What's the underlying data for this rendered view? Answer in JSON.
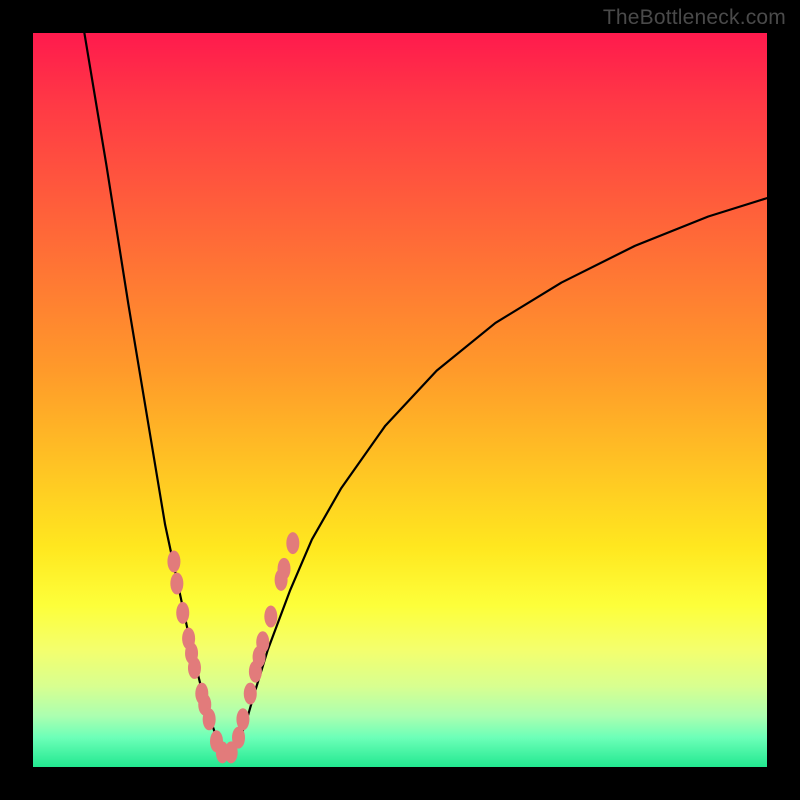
{
  "watermark": "TheBottleneck.com",
  "chart_data": {
    "type": "line",
    "title": "",
    "xlabel": "",
    "ylabel": "",
    "xlim": [
      0,
      100
    ],
    "ylim": [
      0,
      100
    ],
    "grid": false,
    "legend": false,
    "curve_description": "Sharp V-shaped bottleneck curve descending steeply to a minimum near x≈26 then rising more gradually toward the right edge",
    "series": [
      {
        "name": "left-branch",
        "x": [
          7.0,
          10.0,
          13.0,
          16.0,
          18.0,
          19.5,
          21.0,
          22.0,
          23.0,
          24.0,
          25.0,
          25.5,
          26.0
        ],
        "y": [
          100.0,
          82.0,
          63.0,
          45.0,
          33.0,
          26.0,
          19.0,
          14.5,
          10.5,
          7.0,
          4.0,
          2.5,
          1.5
        ]
      },
      {
        "name": "right-branch",
        "x": [
          26.0,
          27.0,
          28.0,
          29.0,
          30.0,
          32.0,
          35.0,
          38.0,
          42.0,
          48.0,
          55.0,
          63.0,
          72.0,
          82.0,
          92.0,
          100.0
        ],
        "y": [
          1.5,
          2.0,
          3.5,
          6.0,
          9.5,
          16.0,
          24.0,
          31.0,
          38.0,
          46.5,
          54.0,
          60.5,
          66.0,
          71.0,
          75.0,
          77.5
        ]
      }
    ],
    "highlight_points": {
      "name": "highlight-ovals",
      "color": "#e27b7b",
      "points": [
        {
          "x": 19.2,
          "y": 28.0
        },
        {
          "x": 19.6,
          "y": 25.0
        },
        {
          "x": 20.4,
          "y": 21.0
        },
        {
          "x": 21.2,
          "y": 17.5
        },
        {
          "x": 21.6,
          "y": 15.5
        },
        {
          "x": 22.0,
          "y": 13.5
        },
        {
          "x": 23.0,
          "y": 10.0
        },
        {
          "x": 23.4,
          "y": 8.5
        },
        {
          "x": 24.0,
          "y": 6.5
        },
        {
          "x": 25.0,
          "y": 3.5
        },
        {
          "x": 25.8,
          "y": 2.0
        },
        {
          "x": 27.0,
          "y": 2.0
        },
        {
          "x": 28.0,
          "y": 4.0
        },
        {
          "x": 28.6,
          "y": 6.5
        },
        {
          "x": 29.6,
          "y": 10.0
        },
        {
          "x": 30.3,
          "y": 13.0
        },
        {
          "x": 30.8,
          "y": 15.0
        },
        {
          "x": 31.3,
          "y": 17.0
        },
        {
          "x": 32.4,
          "y": 20.5
        },
        {
          "x": 33.8,
          "y": 25.5
        },
        {
          "x": 34.2,
          "y": 27.0
        },
        {
          "x": 35.4,
          "y": 30.5
        }
      ]
    },
    "gradient_stops": [
      {
        "pos": 0.0,
        "color": "#ff1a4d"
      },
      {
        "pos": 0.1,
        "color": "#ff3a45"
      },
      {
        "pos": 0.22,
        "color": "#ff5a3c"
      },
      {
        "pos": 0.34,
        "color": "#ff7a33"
      },
      {
        "pos": 0.46,
        "color": "#ff9a2a"
      },
      {
        "pos": 0.58,
        "color": "#ffc024"
      },
      {
        "pos": 0.7,
        "color": "#ffe71f"
      },
      {
        "pos": 0.78,
        "color": "#fdff3a"
      },
      {
        "pos": 0.84,
        "color": "#f4ff6d"
      },
      {
        "pos": 0.89,
        "color": "#d8ff90"
      },
      {
        "pos": 0.93,
        "color": "#acffb0"
      },
      {
        "pos": 0.96,
        "color": "#6cffb8"
      },
      {
        "pos": 1.0,
        "color": "#22e890"
      }
    ]
  }
}
